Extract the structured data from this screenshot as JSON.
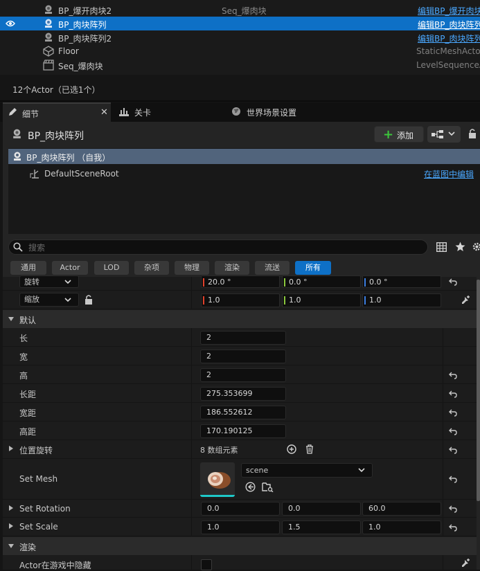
{
  "outliner": {
    "rows": [
      {
        "name": "BP_爆开肉块2",
        "type": "Seq_爆肉块",
        "action": "编辑BP_爆开肉块2",
        "selected": false
      },
      {
        "name": "BP_肉块阵列",
        "type": "",
        "action": "编辑BP_肉块阵列",
        "selected": true
      },
      {
        "name": "BP_肉块阵列2",
        "type": "",
        "action": "编辑BP_肉块阵列2",
        "selected": false
      },
      {
        "name": "Floor",
        "type": "",
        "action": "StaticMeshActor",
        "selected": false
      },
      {
        "name": "Seq_爆肉块",
        "type": "",
        "action": "LevelSequenceActor",
        "selected": false
      }
    ],
    "actor_count": "12个Actor（已选1个）"
  },
  "tabs": [
    {
      "label": "细节",
      "active": true,
      "icon": "pencil-icon"
    },
    {
      "label": "关卡",
      "active": false,
      "icon": "level-icon"
    },
    {
      "label": "世界场景设置",
      "active": false,
      "icon": "globe-icon"
    }
  ],
  "details": {
    "actor_name": "BP_肉块阵列",
    "add_label": "添加",
    "components": [
      {
        "label": "BP_肉块阵列 （自我）"
      },
      {
        "label": "DefaultSceneRoot"
      }
    ],
    "edit_in_blueprint": "在蓝图中编辑",
    "search_placeholder": "搜索",
    "filters": [
      "通用",
      "Actor",
      "LOD",
      "杂项",
      "物理",
      "渲染",
      "流送",
      "所有"
    ],
    "active_filter": "所有"
  },
  "transform": {
    "rotation": {
      "label": "旋转",
      "x": "20.0 °",
      "y": "0.0 °",
      "z": "0.0 °"
    },
    "scale": {
      "label": "缩放",
      "x": "1.0",
      "y": "1.0",
      "z": "1.0"
    }
  },
  "default_category": {
    "label": "默认",
    "props": [
      {
        "name": "长",
        "value": "2"
      },
      {
        "name": "宽",
        "value": "2"
      },
      {
        "name": "高",
        "value": "2"
      },
      {
        "name": "长距",
        "value": "275.353699"
      },
      {
        "name": "宽距",
        "value": "186.552612"
      },
      {
        "name": "高距",
        "value": "170.190125"
      }
    ],
    "position_rotation": {
      "name": "位置旋转",
      "value": "8 数组元素"
    },
    "set_mesh": {
      "name": "Set Mesh",
      "asset": "scene"
    },
    "set_rotation": {
      "name": "Set Rotation",
      "x": "0.0",
      "y": "0.0",
      "z": "60.0"
    },
    "set_scale": {
      "name": "Set Scale",
      "x": "1.0",
      "y": "1.5",
      "z": "1.0"
    }
  },
  "render_category": {
    "label": "渲染",
    "hidden_in_game": {
      "name": "Actor在游戏中隐藏",
      "checked": false
    }
  },
  "colors": {
    "selection": "#0e70c6",
    "link": "#4aa8ff",
    "add_plus": "#3cc63c"
  }
}
